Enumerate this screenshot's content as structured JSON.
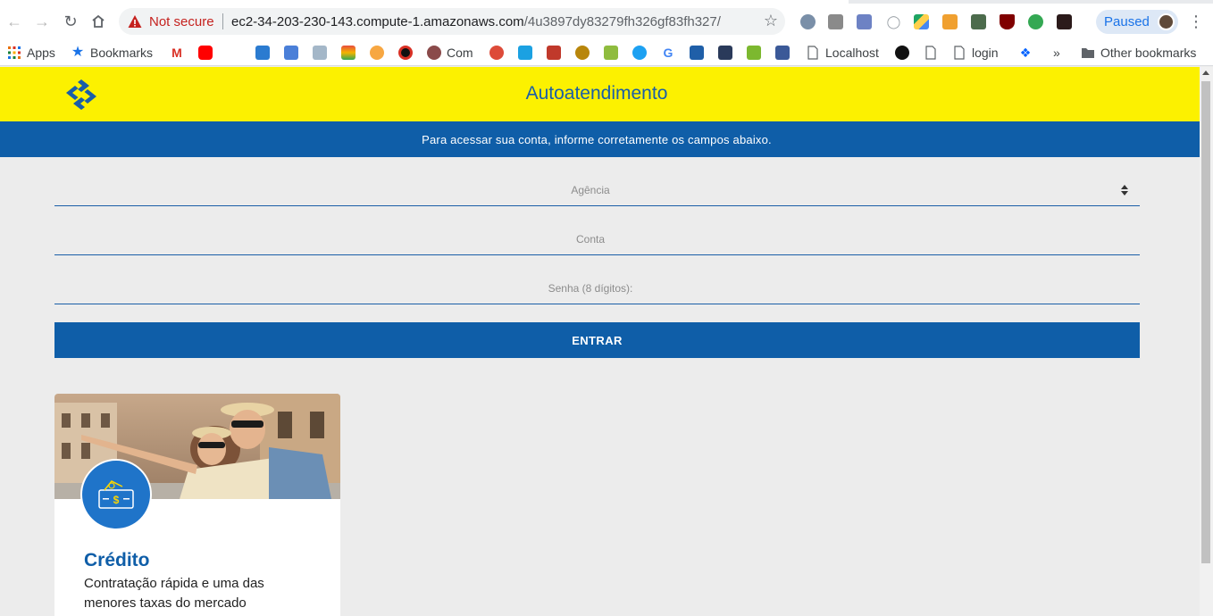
{
  "browser": {
    "security_label": "Not secure",
    "url_host": "ec2-34-203-230-143.compute-1.amazonaws.com",
    "url_path": "/4u3897dy83279fh326gf83fh327/",
    "profile_status": "Paused",
    "bookmarks": {
      "apps": "Apps",
      "bookmarks": "Bookmarks",
      "com": "Com",
      "localhost": "Localhost",
      "login": "login",
      "more": "»",
      "other": "Other bookmarks"
    }
  },
  "page": {
    "header_title": "Autoatendimento",
    "subheader": "Para acessar sua conta, informe corretamente os campos abaixo.",
    "fields": {
      "agencia": "Agência",
      "conta": "Conta",
      "senha": "Senha (8 dígitos):"
    },
    "submit_label": "ENTRAR",
    "card": {
      "title": "Crédito",
      "description": "Contratação rápida e uma das menores taxas do mercado"
    }
  },
  "colors": {
    "brand_yellow": "#fcf100",
    "brand_blue": "#0f5ea8"
  }
}
